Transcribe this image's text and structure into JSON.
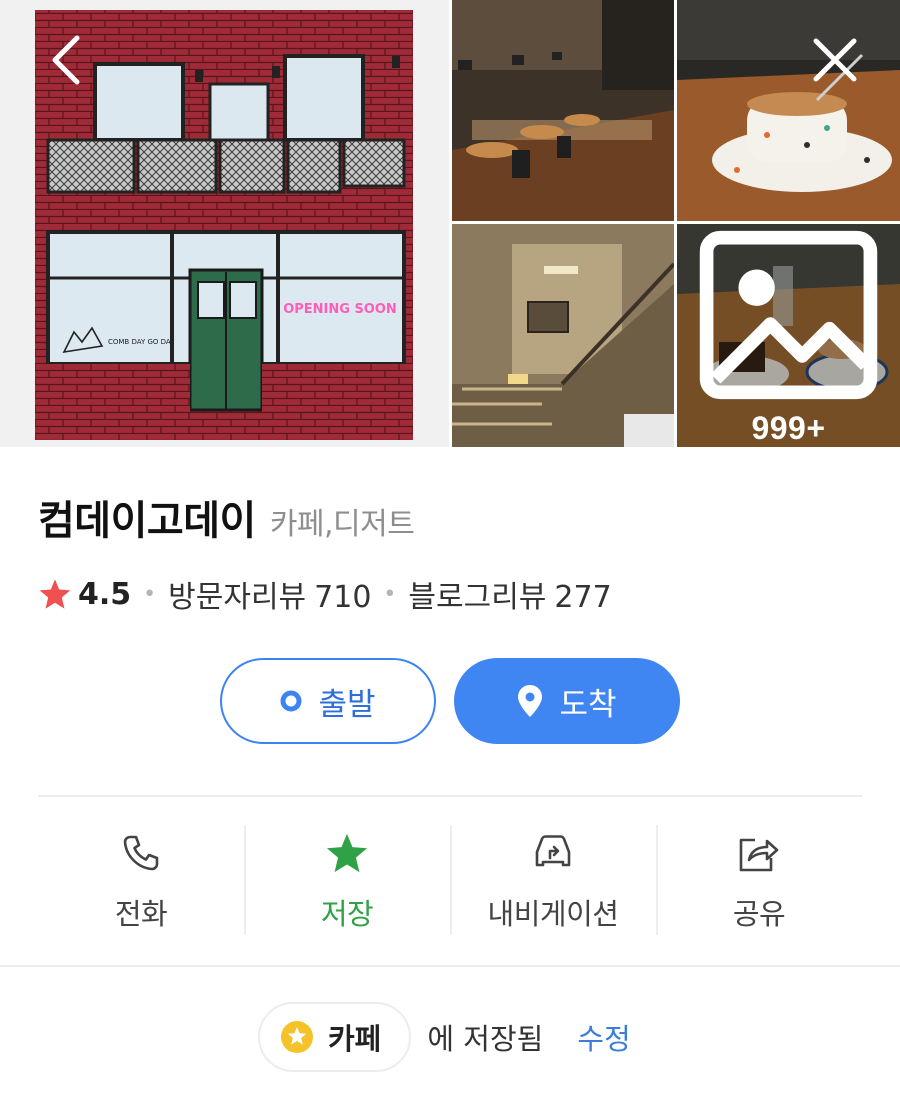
{
  "gallery": {
    "more_count": "999+",
    "photos": [
      "storefront-illustration",
      "cafe-interior",
      "coffee-cup",
      "staircase",
      "dessert-table"
    ]
  },
  "nav": {
    "back_icon": "chevron-left-icon",
    "close_icon": "close-icon"
  },
  "place": {
    "name": "컴데이고데이",
    "category": "카페,디저트",
    "rating": "4.5",
    "visitor_review_label": "방문자리뷰",
    "visitor_review_count": "710",
    "blog_review_label": "블로그리뷰",
    "blog_review_count": "277"
  },
  "route": {
    "depart_label": "출발",
    "arrive_label": "도착"
  },
  "actions": {
    "call_label": "전화",
    "save_label": "저장",
    "navigation_label": "내비게이션",
    "share_label": "공유"
  },
  "saved": {
    "folder_name": "카페",
    "saved_text": "에 저장됨",
    "edit_label": "수정"
  },
  "colors": {
    "accent_blue": "#3f86f3",
    "saved_green": "#2fa247",
    "rating_star": "#f0504f",
    "folder_star": "#f5c22a"
  },
  "illustration_text": {
    "sign": "OPENING SOON",
    "window_text": "COMB DAY GO DAY"
  }
}
